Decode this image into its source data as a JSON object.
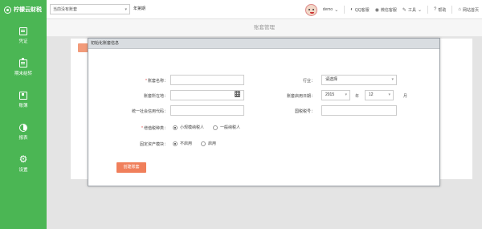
{
  "topbar": {
    "brand": "柠檬云财税",
    "account_placeholder": "当前没有账套",
    "period": "年第期",
    "user": "demo",
    "tools": [
      "QQ客服",
      "微信客服",
      "工具",
      "帮助",
      "网站首页"
    ]
  },
  "sidebar": {
    "items": [
      {
        "label": "凭证",
        "icon": "voucher-icon"
      },
      {
        "label": "期末结转",
        "icon": "clipboard-icon"
      },
      {
        "label": "账簿",
        "icon": "book-icon"
      },
      {
        "label": "报表",
        "icon": "pie-chart-icon"
      },
      {
        "label": "设置",
        "icon": "gear-icon"
      }
    ]
  },
  "page": {
    "title": "账套管理"
  },
  "modal": {
    "title": "初始化账套信息",
    "labels": {
      "account_name": "账套名称：",
      "industry": "行业：",
      "location": "账套所在地：",
      "start_date": "账套启用日期：",
      "credit_code": "统一社会信用代码：",
      "tax_id": "国税税号：",
      "vat_type": "增值税种类：",
      "fixed_asset": "固定资产模块："
    },
    "industry_value": "请选择",
    "year_value": "2015",
    "year_unit": "年",
    "month_value": "12",
    "month_unit": "月",
    "vat_options": [
      "小规模纳税人",
      "一般纳税人"
    ],
    "asset_options": [
      "不启用",
      "启用"
    ],
    "create_button": "创建账套"
  },
  "colors": {
    "brand_green": "#4bb654",
    "create_button": "#f07f5b"
  }
}
